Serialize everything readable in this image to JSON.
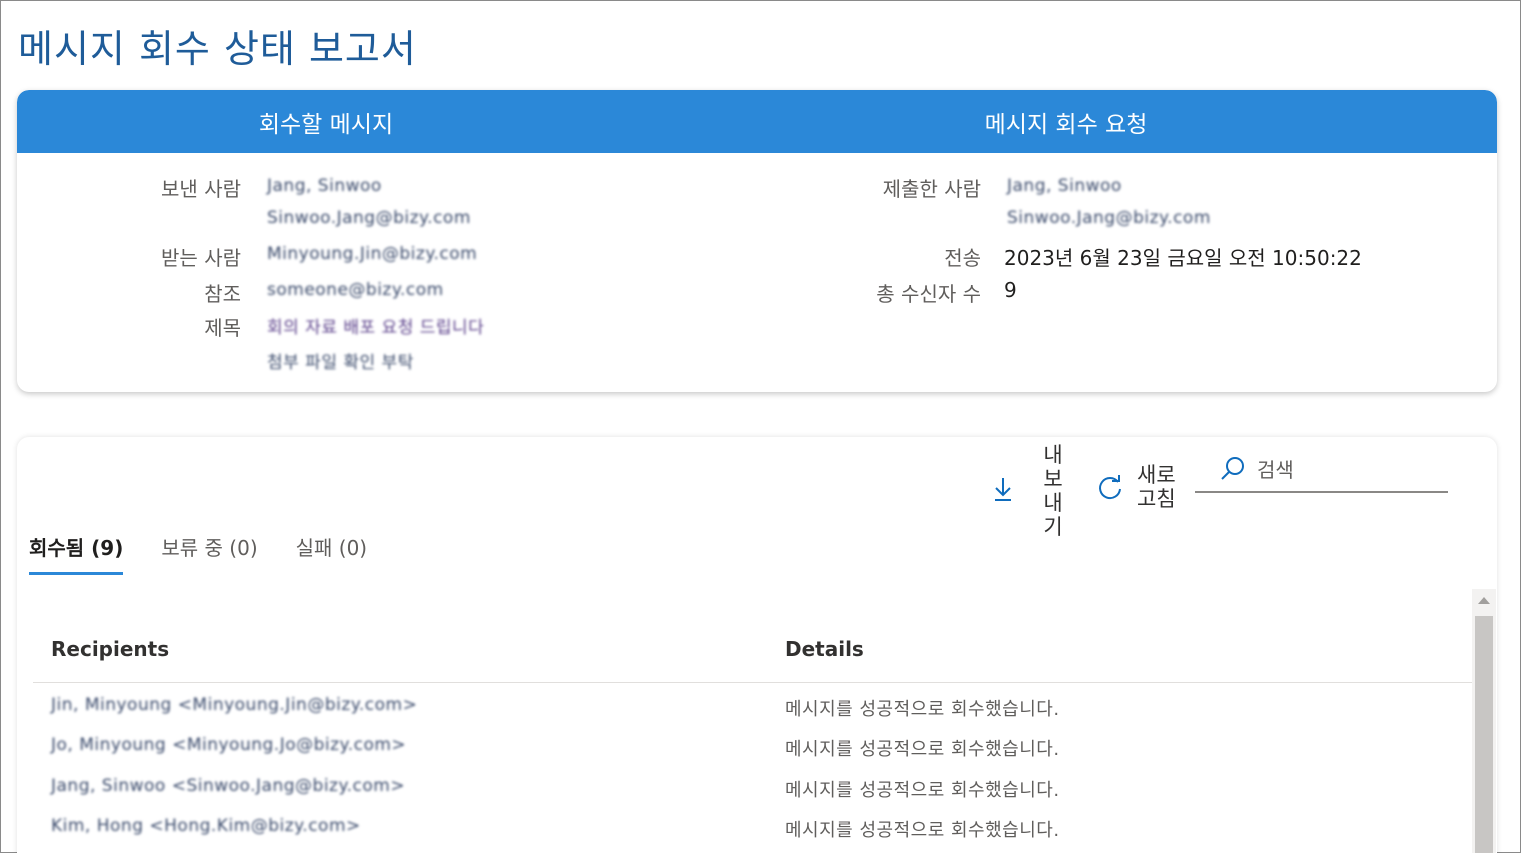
{
  "page": {
    "title": "메시지 회수 상태 보고서"
  },
  "summary": {
    "left_header": "회수할 메시지",
    "right_header": "메시지 회수 요청",
    "sender_label": "보낸 사람",
    "sender_name": "Jang, Sinwoo",
    "sender_email": "Sinwoo.Jang@bizy.com",
    "to_label": "받는 사람",
    "to_value": "Minyoung.Jin@bizy.com",
    "cc_label": "참조",
    "cc_value": "someone@bizy.com",
    "subject_label": "제목",
    "subject_line1": "회의 자료 배포 요청 드립니다",
    "subject_line2": "첨부 파일 확인 부탁",
    "submitter_label": "제출한 사람",
    "submitter_name": "Jang, Sinwoo",
    "submitter_email": "Sinwoo.Jang@bizy.com",
    "sent_label": "전송",
    "sent_value": "2023년 6월 23일 금요일 오전 10:50:22",
    "total_label": "총 수신자 수",
    "total_value": "9"
  },
  "toolbar": {
    "export_label": "내보내기",
    "refresh_label": "새로고침",
    "search_placeholder": "검색"
  },
  "tabs": [
    {
      "label": "회수됨 (9)",
      "active": true
    },
    {
      "label": "보류 중 (0)",
      "active": false
    },
    {
      "label": "실패 (0)",
      "active": false
    }
  ],
  "table": {
    "columns": [
      "Recipients",
      "Details"
    ],
    "rows": [
      {
        "recipient": "Jin, Minyoung <Minyoung.Jin@bizy.com>",
        "details": "메시지를 성공적으로 회수했습니다."
      },
      {
        "recipient": "Jo, Minyoung <Minyoung.Jo@bizy.com>",
        "details": "메시지를 성공적으로 회수했습니다."
      },
      {
        "recipient": "Jang, Sinwoo <Sinwoo.Jang@bizy.com>",
        "details": "메시지를 성공적으로 회수했습니다."
      },
      {
        "recipient": "Kim, Hong <Hong.Kim@bizy.com>",
        "details": "메시지를 성공적으로 회수했습니다."
      }
    ]
  },
  "colors": {
    "accent": "#2b88d8",
    "title": "#1f5c99"
  },
  "icons": [
    "download-icon",
    "refresh-icon",
    "search-icon",
    "scroll-up-icon"
  ]
}
